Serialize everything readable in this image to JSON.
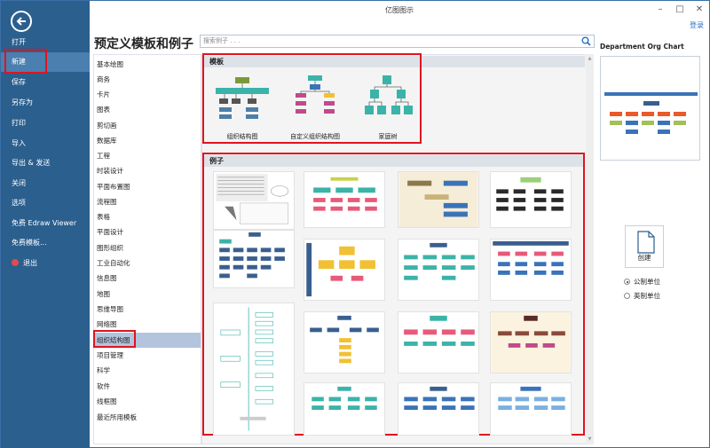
{
  "window": {
    "title": "亿图图示",
    "login": "登录"
  },
  "nav": {
    "items": [
      {
        "label": "打开"
      },
      {
        "label": "新建",
        "active": true
      },
      {
        "label": "保存"
      },
      {
        "label": "另存为"
      },
      {
        "label": "打印"
      },
      {
        "label": "导入"
      },
      {
        "label": "导出 & 发送"
      },
      {
        "label": "关闭"
      },
      {
        "label": "选项"
      },
      {
        "label": "免费 Edraw Viewer"
      },
      {
        "label": "免费模板..."
      },
      {
        "label": "退出"
      }
    ]
  },
  "main": {
    "title": "预定义模板和例子",
    "search_placeholder": "搜索例子 . . .",
    "categories": [
      "基本绘图",
      "商务",
      "卡片",
      "图表",
      "剪切画",
      "数据库",
      "工程",
      "时装设计",
      "平面布置图",
      "流程图",
      "表格",
      "平面设计",
      "图形组织",
      "工业自动化",
      "信息图",
      "地图",
      "思维导图",
      "网络图",
      "组织结构图",
      "项目管理",
      "科学",
      "软件",
      "线框图",
      "最近所用模板"
    ],
    "active_category": "组织结构图",
    "templates_header": "模板",
    "templates": [
      {
        "label": "组织结构图",
        "icon": "org-chart-icon"
      },
      {
        "label": "自定义组织结构图",
        "icon": "custom-org-chart-icon"
      },
      {
        "label": "家庭树",
        "icon": "family-tree-icon"
      }
    ],
    "examples_header": "例子"
  },
  "right": {
    "preview_title": "Department Org Chart",
    "create_label": "创建",
    "units": [
      {
        "label": "公制单位",
        "selected": true
      },
      {
        "label": "英制单位",
        "selected": false
      }
    ]
  },
  "colors": {
    "nav_bg": "#2b5f8e",
    "highlight": "#e0141e",
    "active_category": "#b3c4dd"
  }
}
